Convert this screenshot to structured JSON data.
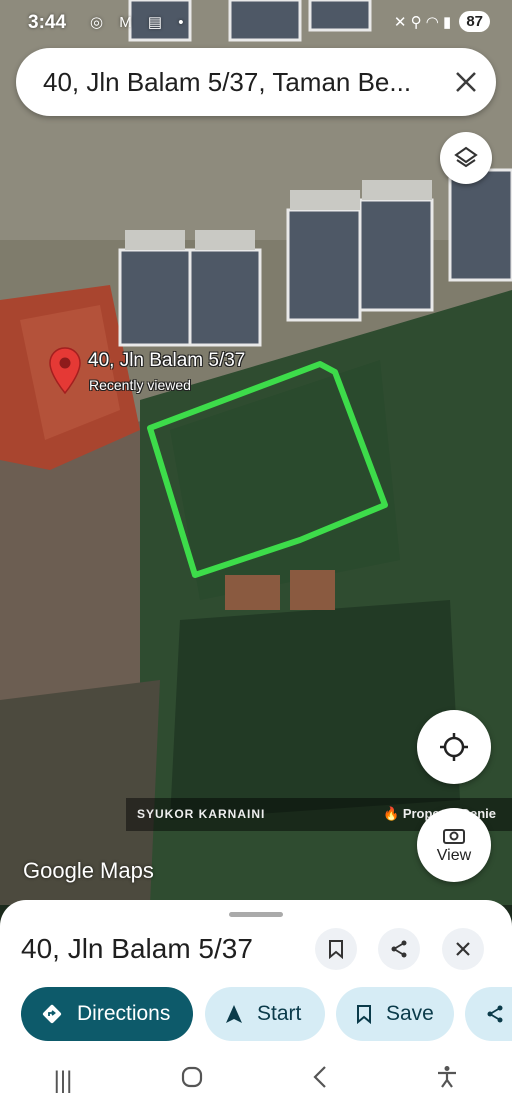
{
  "status_bar": {
    "time": "3:44",
    "left_icons": "◎ M ▤ •",
    "right_icons": "✕ ⚲ ◠ ▮",
    "battery": "87"
  },
  "search": {
    "query": "40, Jln Balam 5/37, Taman Be...",
    "close_icon": "close-icon"
  },
  "map": {
    "pin_title": "40, Jln Balam 5/37",
    "pin_subtitle": "Recently viewed",
    "outline_color": "#3ddc4a",
    "pin_color": "#e53935",
    "watermark_left": "SYUKOR KARNAINI",
    "watermark_right": "Property Genie",
    "logo": "Google Maps",
    "view_label": "View"
  },
  "sheet": {
    "title": "40, Jln Balam 5/37",
    "chips": {
      "directions": "Directions",
      "start": "Start",
      "save": "Save"
    },
    "accent": "#0d5a6a",
    "chip_bg": "#d6ecf5"
  },
  "nav": {
    "recents": "|||",
    "home": "○",
    "back": "‹",
    "accessibility": "♿"
  }
}
